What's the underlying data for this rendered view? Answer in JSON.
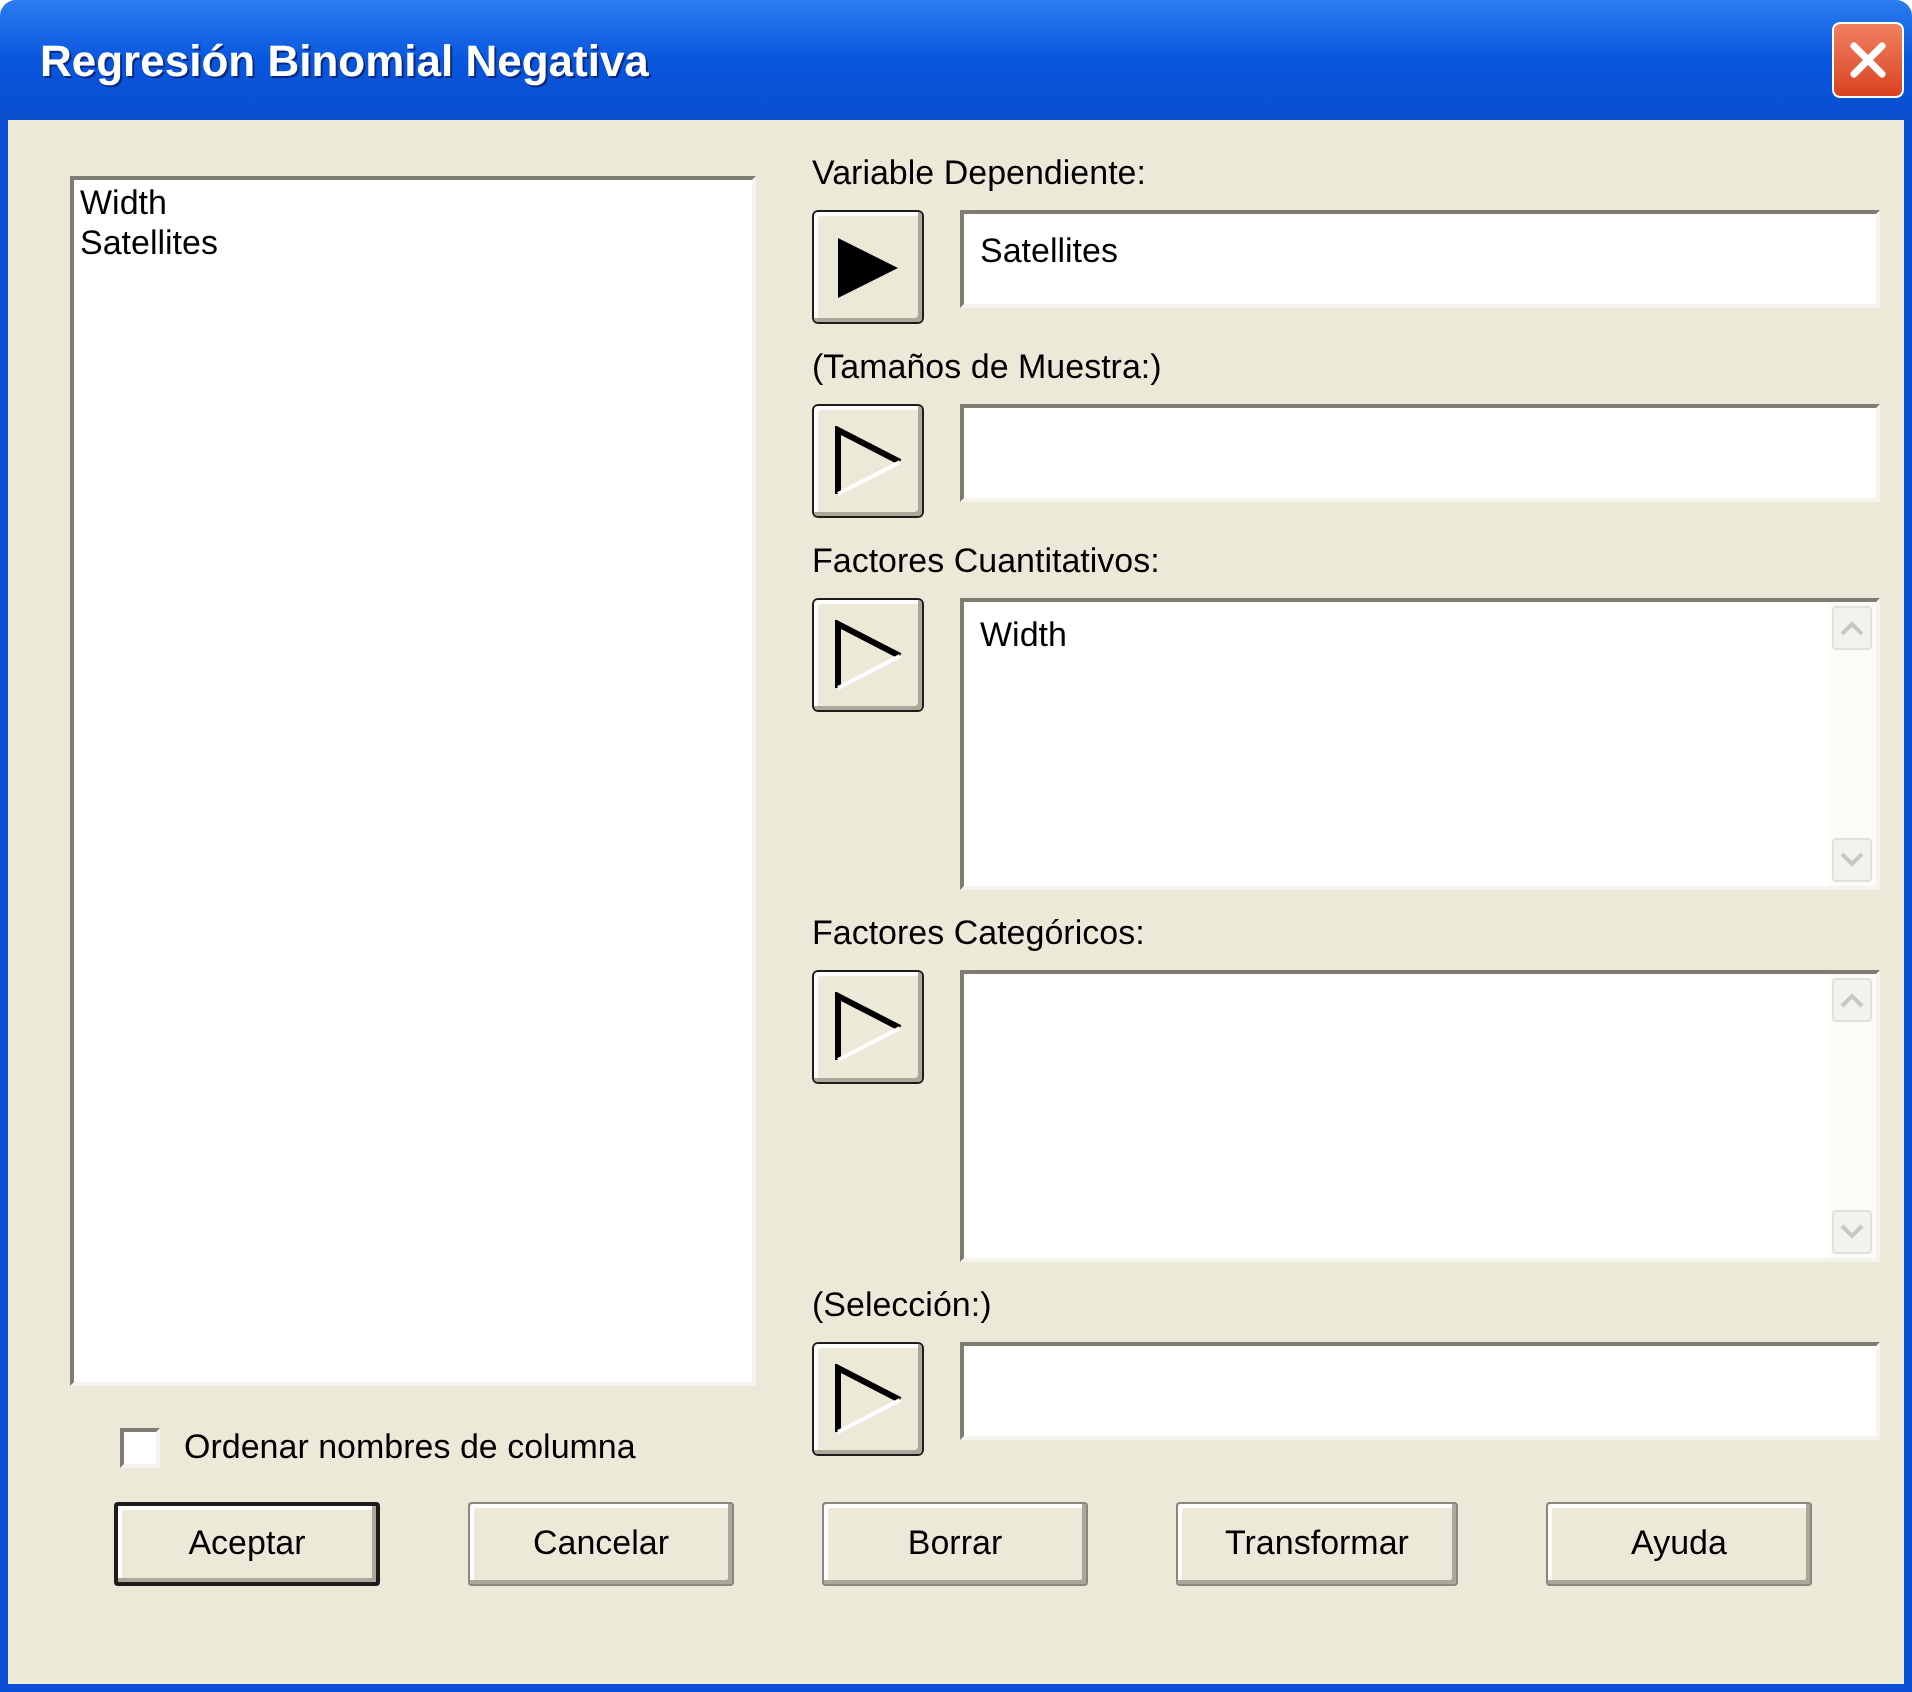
{
  "window": {
    "title": "Regresión Binomial Negativa"
  },
  "columns_list": {
    "items": [
      "Width",
      "Satellites"
    ]
  },
  "sort_option": {
    "label": "Ordenar nombres de columna",
    "checked": false
  },
  "inputs": [
    {
      "label": "Variable Dependiente:",
      "kind": "field",
      "arrow_filled": true,
      "value": "Satellites"
    },
    {
      "label": "(Tamaños de Muestra:)",
      "kind": "field",
      "arrow_filled": false
    },
    {
      "label": "Factores Cuantitativos:",
      "kind": "list",
      "arrow_filled": false,
      "items": [
        "Width"
      ]
    },
    {
      "label": "Factores Categóricos:",
      "kind": "list",
      "arrow_filled": false
    },
    {
      "label": "(Selección:)",
      "kind": "field",
      "arrow_filled": false
    }
  ],
  "buttons": [
    {
      "label": "Aceptar",
      "default": true
    },
    {
      "label": "Cancelar",
      "default": false
    },
    {
      "label": "Borrar",
      "default": false
    },
    {
      "label": "Transformar",
      "default": false
    },
    {
      "label": "Ayuda",
      "default": false
    }
  ]
}
